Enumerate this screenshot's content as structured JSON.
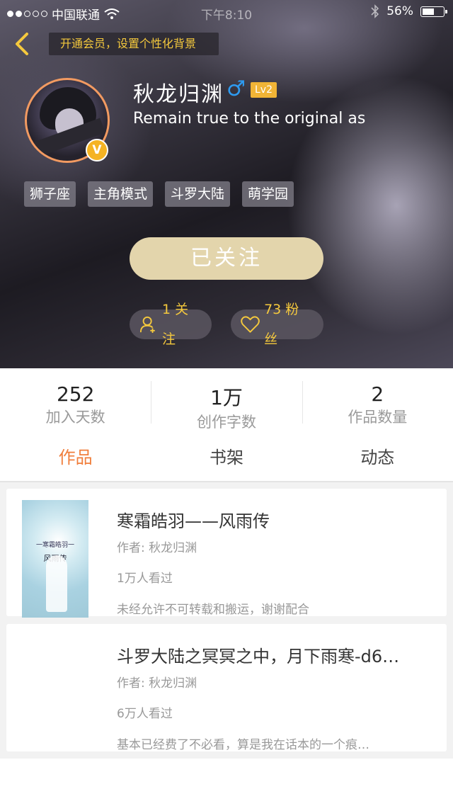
{
  "status_bar": {
    "carrier": "中国联通",
    "time": "下午8:10",
    "battery": "56%",
    "battery_level": 0.56
  },
  "header": {
    "vip_prompt": "开通会员，设置个性化背景",
    "username": "秋龙归渊",
    "gender_symbol": "♂",
    "level": "Lv2",
    "verified_badge": "V",
    "signature": "Remain true to the original as",
    "tags": [
      "狮子座",
      "主角模式",
      "斗罗大陆",
      "萌学园"
    ],
    "follow_button": "已关注",
    "following": "1 关注",
    "fans": "73 粉丝"
  },
  "stats": [
    {
      "value": "252",
      "label": "加入天数"
    },
    {
      "value": "1万",
      "label": "创作字数"
    },
    {
      "value": "2",
      "label": "作品数量"
    }
  ],
  "tabs": [
    {
      "label": "作品",
      "active": true
    },
    {
      "label": "书架",
      "active": false
    },
    {
      "label": "动态",
      "active": false
    }
  ],
  "works": [
    {
      "title": "寒霜皓羽——风雨传",
      "author": "作者: 秋龙归渊",
      "views": "1万人看过",
      "description": "未经允许不可转载和搬运，谢谢配合",
      "cover_small": "一寒霜皓羽一",
      "cover_large": "风雨传"
    },
    {
      "title": "斗罗大陆之冥冥之中，月下雨寒-d6…",
      "author": "作者: 秋龙归渊",
      "views": "6万人看过",
      "description": "基本已经费了不必看，算是我在话本的一个痕…"
    }
  ],
  "colors": {
    "accent_orange": "#f07e3c",
    "vip_gold": "#f5c93d",
    "follow_button_bg": "#e3d5ac",
    "gender_blue": "#2e9bf0"
  }
}
